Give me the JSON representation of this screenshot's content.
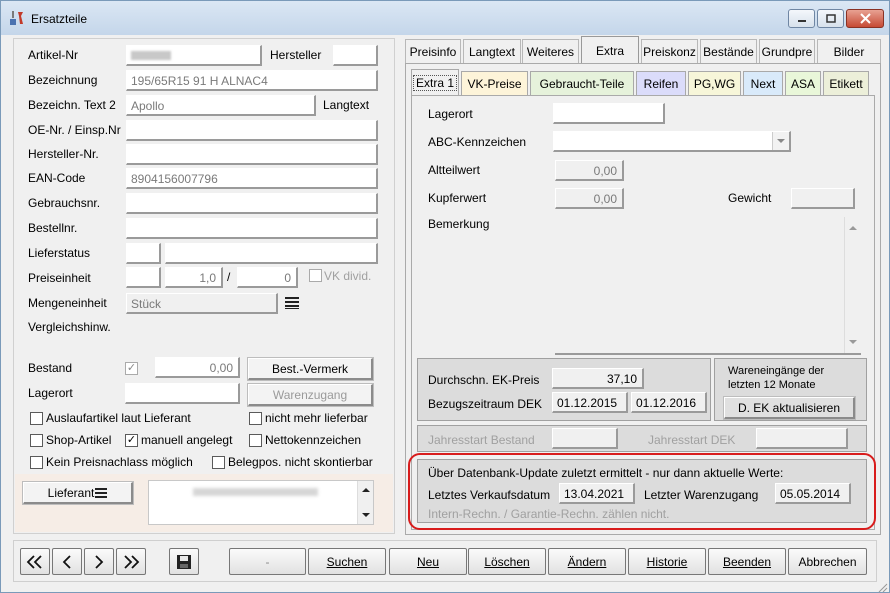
{
  "window": {
    "title": "Ersatzteile"
  },
  "left": {
    "labels": {
      "artikel_nr": "Artikel-Nr",
      "hersteller": "Hersteller",
      "bezeichnung": "Bezeichnung",
      "bezeichn_text2": "Bezeichn. Text 2",
      "langtext": "Langtext",
      "oe_nr": "OE-Nr. / Einsp.Nr",
      "hersteller_nr": "Hersteller-Nr.",
      "ean": "EAN-Code",
      "gebrauchsnr": "Gebrauchsnr.",
      "bestellnr": "Bestellnr.",
      "lieferstatus": "Lieferstatus",
      "preiseinheit": "Preiseinheit",
      "slash": "/",
      "vk_divid": "VK divid.",
      "mengeneinheit": "Mengeneinheit",
      "vergleichshinw": "Vergleichshinw.",
      "bestand": "Bestand",
      "lagerort": "Lagerort"
    },
    "values": {
      "bezeichnung": "195/65R15 91 H ALNAC4",
      "bezeichn_text2": "Apollo",
      "ean": "8904156007796",
      "preiseinheit_a": "1,0",
      "preiseinheit_b": "0",
      "mengeneinheit": "Stück",
      "bestand": "0,00"
    },
    "buttons": {
      "best_vermerk": "Best.-Vermerk",
      "warenzugang": "Warenzugang",
      "lieferant": "Lieferant"
    },
    "checkboxes": {
      "auslaufartikel": "Auslaufartikel laut Lieferant",
      "nicht_mehr_lieferbar": "nicht mehr lieferbar",
      "shop_artikel": "Shop-Artikel",
      "manuell_angelegt": "manuell angelegt",
      "nettokennzeichen": "Nettokennzeichen",
      "kein_preisnachlass": "Kein Preisnachlass möglich",
      "belegpos": "Belegpos. nicht skontierbar"
    }
  },
  "tabs": [
    "Preisinfo",
    "Langtext",
    "Weiteres",
    "Extra",
    "Preiskonz",
    "Bestände",
    "Grundpre",
    "Bilder"
  ],
  "subtabs": [
    "Extra 1",
    "VK-Preise",
    "Gebraucht-Teile",
    "Reifen",
    "PG,WG",
    "Next",
    "ASA",
    "Etikett"
  ],
  "extra": {
    "lagerort": "Lagerort",
    "abc": "ABC-Kennzeichen",
    "altteilwert": "Altteilwert",
    "altteilwert_val": "0,00",
    "kupferwert": "Kupferwert",
    "kupferwert_val": "0,00",
    "gewicht": "Gewicht",
    "bemerkung": "Bemerkung"
  },
  "ek": {
    "durchschn_label": "Durchschn. EK-Preis",
    "durchschn_val": "37,10",
    "bezugszeitraum_label": "Bezugszeitraum DEK",
    "von": "01.12.2015",
    "bis": "01.12.2016",
    "waren_text": "Wareneingänge der letzten 12 Monate",
    "aktualisieren": "D. EK aktualisieren",
    "jahresstart_bestand": "Jahresstart Bestand",
    "jahresstart_dek": "Jahresstart DEK"
  },
  "update_box": {
    "heading": "Über Datenbank-Update zuletzt ermittelt - nur dann aktuelle Werte:",
    "letztes_vk_label": "Letztes Verkaufsdatum",
    "letztes_vk": "13.04.2021",
    "letzter_wz_label": "Letzter Warenzugang",
    "letzter_wz": "05.05.2014",
    "note": "Intern-Rechn. / Garantie-Rechn. zählen nicht."
  },
  "bottom": {
    "dash": "-",
    "suchen": "Suchen",
    "neu": "Neu",
    "loeschen": "Löschen",
    "aendern": "Ändern",
    "historie": "Historie",
    "beenden": "Beenden",
    "abbrechen": "Abbrechen"
  },
  "colors": {
    "accent_red": "#d81c1c",
    "subtab_vk": "#fdf4d9",
    "subtab_gebraucht": "#e6f2db",
    "subtab_reifen": "#dbdcfa",
    "subtab_pg": "#f7f6d9",
    "subtab_next": "#d9eafa",
    "subtab_asa": "#e9f7d9",
    "subtab_etikett": "#ecefd9"
  }
}
